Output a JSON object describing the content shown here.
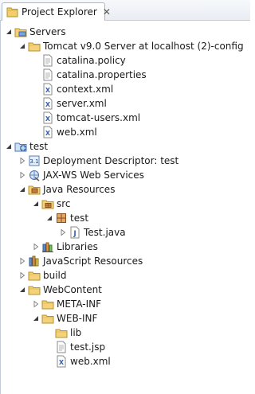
{
  "tab": {
    "title": "Project Explorer",
    "close_glyph": "✕",
    "icon": "folder-tree-icon"
  },
  "tree": [
    {
      "label": "Servers",
      "depth": 0,
      "state": "open",
      "icon": "folder-server"
    },
    {
      "label": "Tomcat v9.0 Server at localhost (2)-config",
      "depth": 1,
      "state": "open",
      "icon": "folder"
    },
    {
      "label": "catalina.policy",
      "depth": 2,
      "state": "none",
      "icon": "file"
    },
    {
      "label": "catalina.properties",
      "depth": 2,
      "state": "none",
      "icon": "file"
    },
    {
      "label": "context.xml",
      "depth": 2,
      "state": "none",
      "icon": "xml"
    },
    {
      "label": "server.xml",
      "depth": 2,
      "state": "none",
      "icon": "xml"
    },
    {
      "label": "tomcat-users.xml",
      "depth": 2,
      "state": "none",
      "icon": "xml"
    },
    {
      "label": "web.xml",
      "depth": 2,
      "state": "none",
      "icon": "xml"
    },
    {
      "label": "test",
      "depth": 0,
      "state": "open",
      "icon": "project"
    },
    {
      "label": "Deployment Descriptor: test",
      "depth": 1,
      "state": "closed",
      "icon": "descriptor"
    },
    {
      "label": "JAX-WS Web Services",
      "depth": 1,
      "state": "closed",
      "icon": "webservice"
    },
    {
      "label": "Java Resources",
      "depth": 1,
      "state": "open",
      "icon": "java-res"
    },
    {
      "label": "src",
      "depth": 2,
      "state": "open",
      "icon": "src"
    },
    {
      "label": "test",
      "depth": 3,
      "state": "open",
      "icon": "package"
    },
    {
      "label": "Test.java",
      "depth": 4,
      "state": "closed",
      "icon": "java"
    },
    {
      "label": "Libraries",
      "depth": 2,
      "state": "closed",
      "icon": "library"
    },
    {
      "label": "JavaScript Resources",
      "depth": 1,
      "state": "closed",
      "icon": "js-res"
    },
    {
      "label": "build",
      "depth": 1,
      "state": "closed",
      "icon": "folder"
    },
    {
      "label": "WebContent",
      "depth": 1,
      "state": "open",
      "icon": "folder"
    },
    {
      "label": "META-INF",
      "depth": 2,
      "state": "closed",
      "icon": "folder"
    },
    {
      "label": "WEB-INF",
      "depth": 2,
      "state": "open",
      "icon": "folder"
    },
    {
      "label": "lib",
      "depth": 3,
      "state": "none",
      "icon": "folder"
    },
    {
      "label": "test.jsp",
      "depth": 3,
      "state": "none",
      "icon": "file"
    },
    {
      "label": "web.xml",
      "depth": 3,
      "state": "none",
      "icon": "xml"
    }
  ]
}
